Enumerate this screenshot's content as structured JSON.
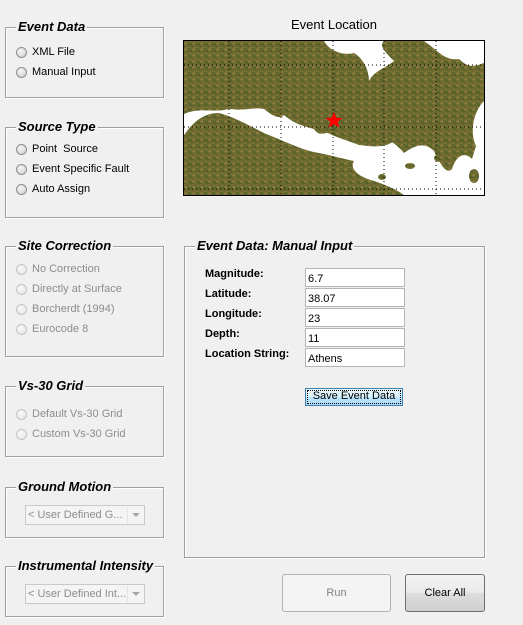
{
  "event_data_group": {
    "title": "Event Data",
    "options": [
      {
        "label": "XML File",
        "selected": false
      },
      {
        "label": "Manual Input",
        "selected": false
      }
    ]
  },
  "source_type_group": {
    "title": "Source Type",
    "options": [
      {
        "label": "Point  Source",
        "selected": false
      },
      {
        "label": "Event Specific Fault",
        "selected": false
      },
      {
        "label": "Auto Assign",
        "selected": false
      }
    ]
  },
  "site_correction_group": {
    "title": "Site Correction",
    "enabled": false,
    "options": [
      {
        "label": "No Correction"
      },
      {
        "label": "Directly at Surface"
      },
      {
        "label": "Borcherdt (1994)"
      },
      {
        "label": "Eurocode 8"
      }
    ]
  },
  "vs30_group": {
    "title": "Vs-30 Grid",
    "enabled": false,
    "options": [
      {
        "label": "Default Vs-30 Grid"
      },
      {
        "label": "Custom Vs-30 Grid"
      }
    ]
  },
  "ground_motion_group": {
    "title": "Ground Motion",
    "selected_value": "< User Defined G...",
    "enabled": false
  },
  "instrumental_intensity_group": {
    "title": "Instrumental Intensity",
    "selected_value": "< User Defined Int...",
    "enabled": false
  },
  "map": {
    "title": "Event Location",
    "marker": "red-star",
    "marker_color": "#ff0000",
    "land_color": "#7a6a2e",
    "water_color": "#ffffff"
  },
  "manual_input_panel": {
    "title": "Event Data: Manual Input",
    "fields": [
      {
        "label": "Magnitude:",
        "value": "6.7"
      },
      {
        "label": "Latitude:",
        "value": "38.07"
      },
      {
        "label": "Longitude:",
        "value": "23"
      },
      {
        "label": "Depth:",
        "value": "11"
      },
      {
        "label": "Location String:",
        "value": "Athens"
      }
    ],
    "save_label": "Save Event Data"
  },
  "actions": {
    "run_label": "Run",
    "run_enabled": false,
    "clear_label": "Clear All"
  }
}
